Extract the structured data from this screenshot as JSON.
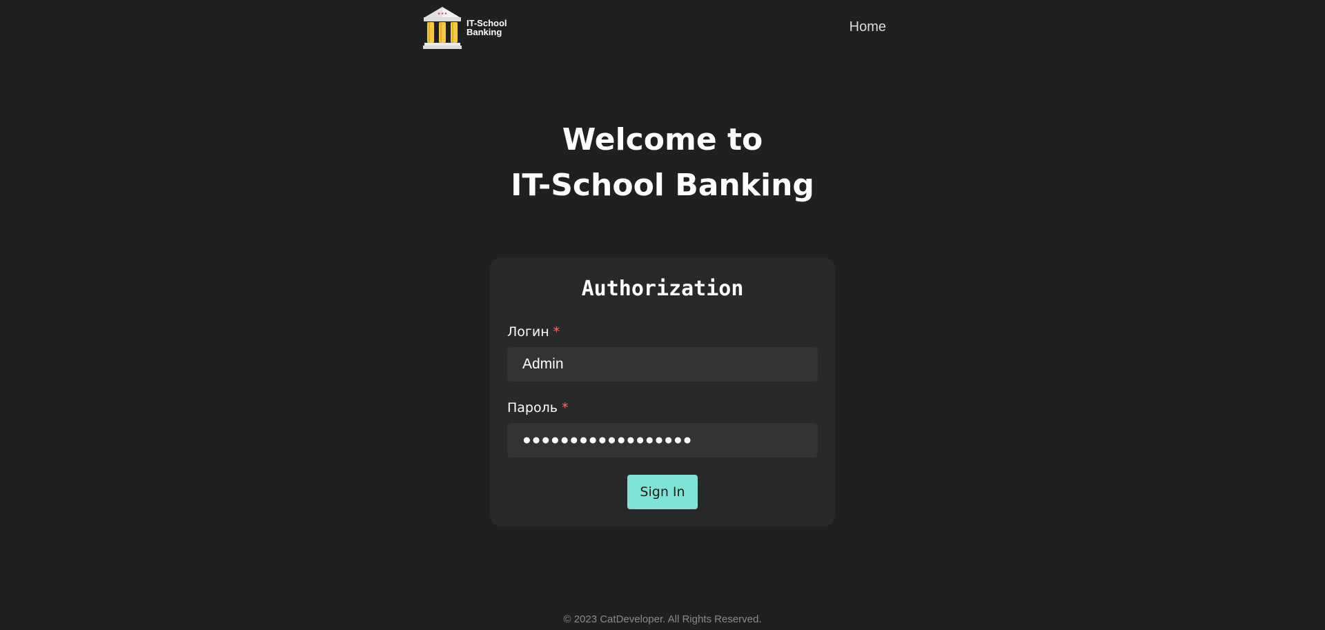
{
  "header": {
    "logo_line1": "IT-School",
    "logo_line2": "Banking",
    "nav_home": "Home"
  },
  "hero": {
    "line1": "Welcome to",
    "line2": "IT-School Banking"
  },
  "auth_form": {
    "title": "Authorization",
    "login_label": "Логин",
    "login_required": "*",
    "login_value": "Admin",
    "password_label": "Пароль",
    "password_required": "*",
    "password_value": "●●●●●●●●●●●●●●●●●●",
    "submit_label": "Sign In"
  },
  "footer": {
    "copyright": "© 2023 CatDeveloper. All Rights Reserved."
  },
  "colors": {
    "background": "#202022",
    "card": "#29292b",
    "input": "#333335",
    "accent": "#7fe3d5",
    "required": "#ff6b6b",
    "logo_columns": "#f5c842"
  },
  "icons": {
    "logo": "bank-building-icon"
  }
}
